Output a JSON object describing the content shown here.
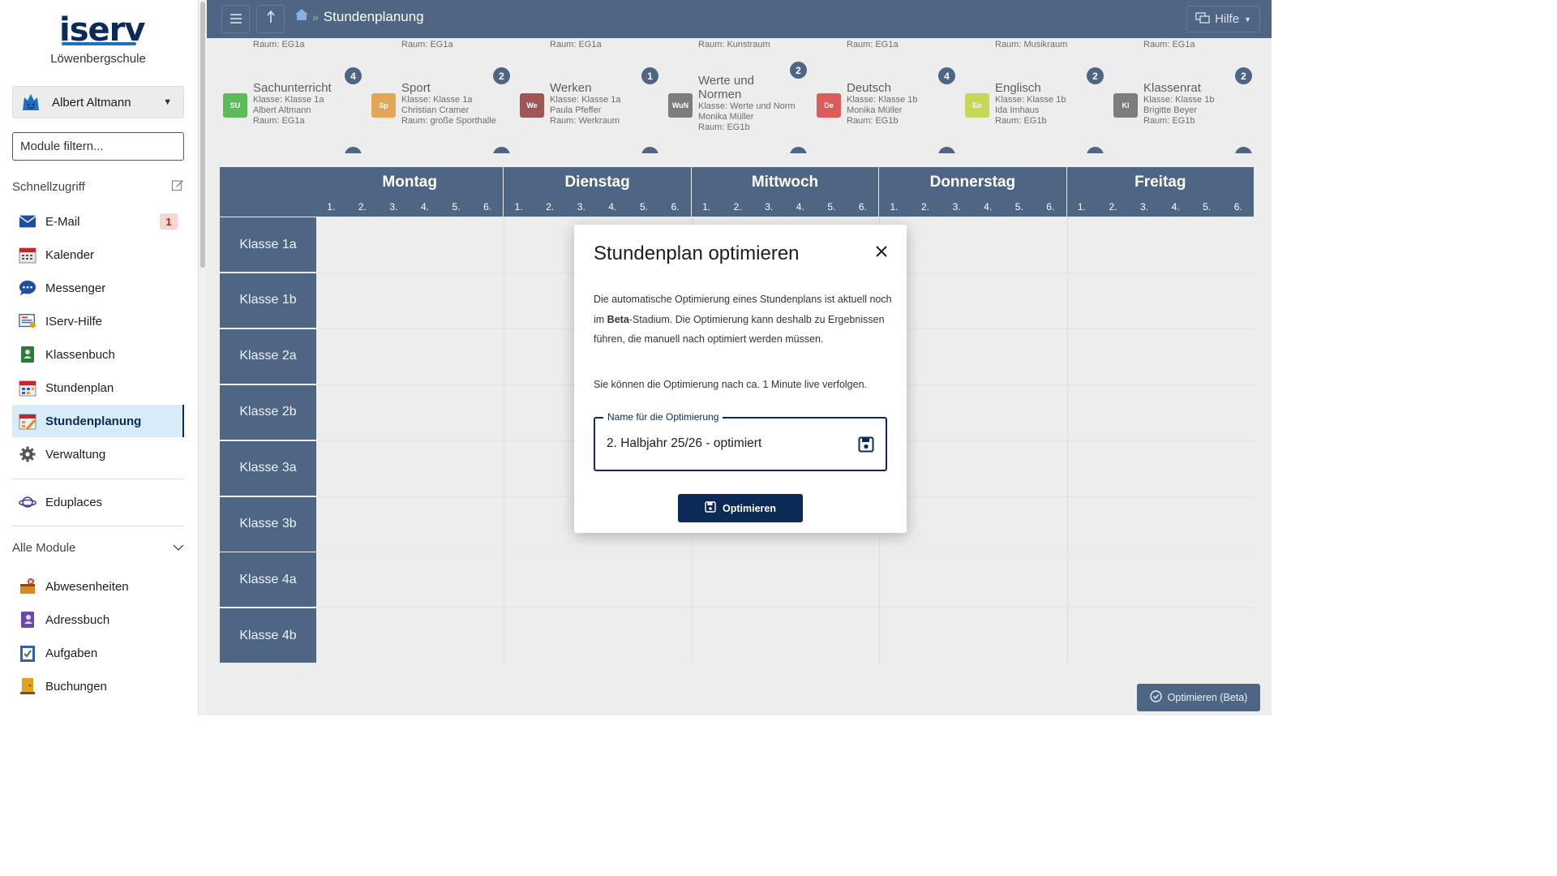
{
  "app": {
    "logo": "iserv",
    "school": "Löwenbergschule"
  },
  "user": {
    "name": "Albert Altmann"
  },
  "filter": {
    "placeholder": "Module filtern..."
  },
  "quick": {
    "title": "Schnellzugriff",
    "items": [
      {
        "label": "E-Mail",
        "icon": "mail-icon",
        "badge": "1"
      },
      {
        "label": "Kalender",
        "icon": "calendar-icon"
      },
      {
        "label": "Messenger",
        "icon": "messenger-icon"
      },
      {
        "label": "IServ-Hilfe",
        "icon": "help-book-icon"
      },
      {
        "label": "Klassenbuch",
        "icon": "class-book-icon"
      },
      {
        "label": "Stundenplan",
        "icon": "timetable-icon"
      },
      {
        "label": "Stundenplanung",
        "icon": "planning-icon"
      },
      {
        "label": "Verwaltung",
        "icon": "gear-icon"
      }
    ],
    "extra": {
      "label": "Eduplaces",
      "icon": "planet-icon"
    }
  },
  "modules": {
    "title": "Alle Module",
    "items": [
      {
        "label": "Abwesenheiten",
        "icon": "absence-icon"
      },
      {
        "label": "Adressbuch",
        "icon": "address-book-icon"
      },
      {
        "label": "Aufgaben",
        "icon": "tasks-icon"
      },
      {
        "label": "Buchungen",
        "icon": "booking-icon"
      }
    ]
  },
  "topbar": {
    "title": "Stundenplanung",
    "help": "Hilfe"
  },
  "strip": {
    "rooms_top": [
      "Raum: EG1a",
      "Raum: EG1a",
      "Raum: EG1a",
      "Raum: Kunstraum",
      "Raum: EG1a",
      "Raum: Musikraum",
      "Raum: EG1a"
    ],
    "cards": [
      {
        "abbr": "SU",
        "color": "#1aa21a",
        "title": "Sachunterricht",
        "lines": [
          "Klasse: Klasse 1a",
          "Albert Altmann",
          "Raum: EG1a"
        ],
        "count": "4"
      },
      {
        "abbr": "Sp",
        "color": "#d98416",
        "title": "Sport",
        "lines": [
          "Klasse: Klasse 1a",
          "Christian Cramer",
          "Raum: große Sporthalle"
        ],
        "count": "2"
      },
      {
        "abbr": "We",
        "color": "#7d1414",
        "title": "Werken",
        "lines": [
          "Klasse: Klasse 1a",
          "Paula Pfeffer",
          "Raum: Werkraum"
        ],
        "count": "1"
      },
      {
        "abbr": "WuN",
        "color": "#4b4b4b",
        "title": "Werte und Normen",
        "lines": [
          "Klasse: Werte und Norm",
          "Monika Müller",
          "Raum: EG1b"
        ],
        "count": "2"
      },
      {
        "abbr": "De",
        "color": "#d11c1c",
        "title": "Deutsch",
        "lines": [
          "Klasse: Klasse 1b",
          "Monika Müller",
          "Raum: EG1b"
        ],
        "count": "4"
      },
      {
        "abbr": "En",
        "color": "#b5c81a",
        "title": "Englisch",
        "lines": [
          "Klasse: Klasse 1b",
          "Ida Imhaus",
          "Raum: EG1b"
        ],
        "count": "2"
      },
      {
        "abbr": "Kl",
        "color": "#4b4b4b",
        "title": "Klassenrat",
        "lines": [
          "Klasse: Klasse 1b",
          "Brigitte Beyer",
          "Raum: EG1b"
        ],
        "count": "2"
      }
    ]
  },
  "grid": {
    "days": [
      "Montag",
      "Dienstag",
      "Mittwoch",
      "Donnerstag",
      "Freitag"
    ],
    "periods": [
      "1.",
      "2.",
      "3.",
      "4.",
      "5.",
      "6."
    ],
    "classes": [
      "Klasse 1a",
      "Klasse 1b",
      "Klasse 2a",
      "Klasse 2b",
      "Klasse 3a",
      "Klasse 3b",
      "Klasse 4a",
      "Klasse 4b"
    ]
  },
  "modal": {
    "title": "Stundenplan optimieren",
    "p1_a": "Die automatische Optimierung eines Stundenplans ist aktuell noch im ",
    "p1_b": "Beta",
    "p1_c": "-Stadium. Die Optimierung kann deshalb zu Ergebnissen führen, die manuell nach optimiert werden müssen.",
    "p2": "Sie können die Optimierung nach ca. 1 Minute live verfolgen.",
    "field_label": "Name für die Optimierung",
    "field_value": "2. Halbjahr 25/26 - optimiert",
    "button": "Optimieren"
  },
  "footer": {
    "button": "Optimieren (Beta)"
  },
  "colors": {
    "navy": "#0b2a55",
    "accent": "#1f6fc5",
    "active_bg": "#d7ecf8"
  }
}
